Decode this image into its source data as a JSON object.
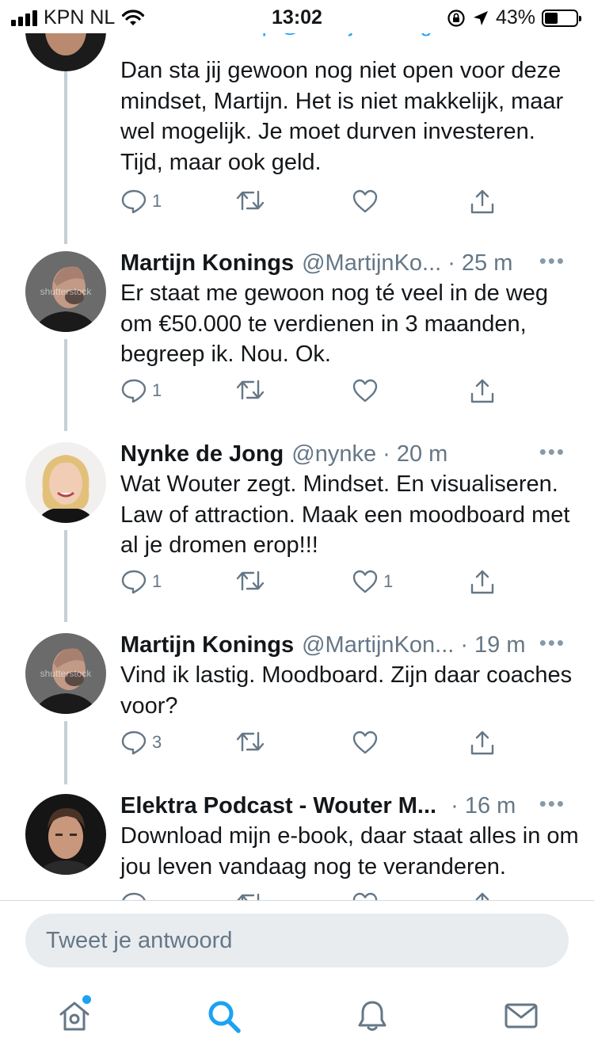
{
  "status_bar": {
    "carrier": "KPN NL",
    "time": "13:02",
    "battery": "43%",
    "battery_level": 0.43
  },
  "tweets": [
    {
      "replying_to": "Als antwoord op @MartijnKonings",
      "text": "Dan sta jij gewoon nog niet open voor deze mindset, Martijn. Het is niet makkelijk, maar wel mogelijk. Je moet durven investeren. Tijd, maar ook geld.",
      "reply_count": "1",
      "like_count": ""
    },
    {
      "name": "Martijn Konings",
      "handle": "@MartijnKo...",
      "time": "· 25 m",
      "avatar_watermark": "shutterstock",
      "text": "Er staat me gewoon nog té veel in de weg om €50.000 te verdienen in 3 maanden, begreep ik. Nou. Ok.",
      "reply_count": "1",
      "like_count": ""
    },
    {
      "name": "Nynke de Jong",
      "handle": "@nynke",
      "time": "· 20 m",
      "text": "Wat Wouter zegt. Mindset. En visualiseren. Law of attraction. Maak een moodboard met al je dromen erop!!!",
      "reply_count": "1",
      "like_count": "1"
    },
    {
      "name": "Martijn Konings",
      "handle": "@MartijnKon...",
      "time": "· 19 m",
      "avatar_watermark": "shutterstock",
      "text": "Vind ik lastig. Moodboard. Zijn daar coaches voor?",
      "reply_count": "3",
      "like_count": ""
    },
    {
      "name": "Elektra Podcast - Wouter M...",
      "handle": "",
      "time": "· 16 m",
      "text": "Download mijn e-book, daar staat alles in om jou leven vandaag nog te veranderen.",
      "reply_count": "",
      "like_count": ""
    }
  ],
  "more_glyph": "•••",
  "compose": {
    "placeholder": "Tweet je antwoord"
  },
  "tabbar": {
    "items": [
      "home-icon",
      "search-icon",
      "bell-icon",
      "mail-icon"
    ],
    "active": "search-icon",
    "home_has_dot": true
  },
  "colors": {
    "accent": "#1da1f2",
    "secondary_text": "#657786",
    "thread_line": "#c4cfd6"
  }
}
